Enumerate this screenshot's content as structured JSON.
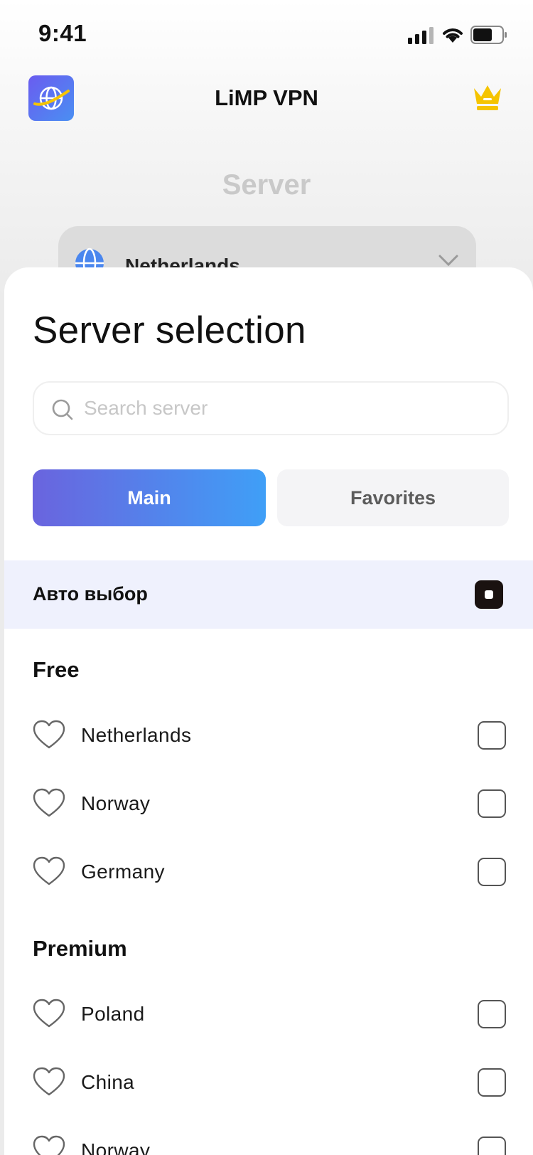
{
  "status_bar": {
    "time": "9:41"
  },
  "header": {
    "title": "LiMP VPN"
  },
  "background": {
    "server_label": "Server",
    "selected_server": "Netherlands"
  },
  "sheet": {
    "title": "Server selection",
    "search": {
      "placeholder": "Search server",
      "value": ""
    },
    "tabs": [
      {
        "label": "Main",
        "active": true
      },
      {
        "label": "Favorites",
        "active": false
      }
    ],
    "auto_select": {
      "label": "Авто выбор",
      "checked": true
    },
    "sections": [
      {
        "title": "Free",
        "items": [
          {
            "label": "Netherlands",
            "favorite": false,
            "checked": false
          },
          {
            "label": "Norway",
            "favorite": false,
            "checked": false
          },
          {
            "label": "Germany",
            "favorite": false,
            "checked": false
          }
        ]
      },
      {
        "title": "Premium",
        "items": [
          {
            "label": "Poland",
            "favorite": false,
            "checked": false
          },
          {
            "label": "China",
            "favorite": false,
            "checked": false
          },
          {
            "label": "Norway",
            "favorite": false,
            "checked": false
          }
        ]
      }
    ]
  },
  "colors": {
    "accent_gradient_start": "#6a64de",
    "accent_gradient_end": "#3f9ff7",
    "crown": "#f5c400",
    "auto_row_bg": "#eff1fd"
  },
  "icons": [
    "globe-logo-icon",
    "crown-icon",
    "globe-icon",
    "chevron-down-icon",
    "search-icon",
    "heart-icon",
    "checkbox-icon"
  ]
}
